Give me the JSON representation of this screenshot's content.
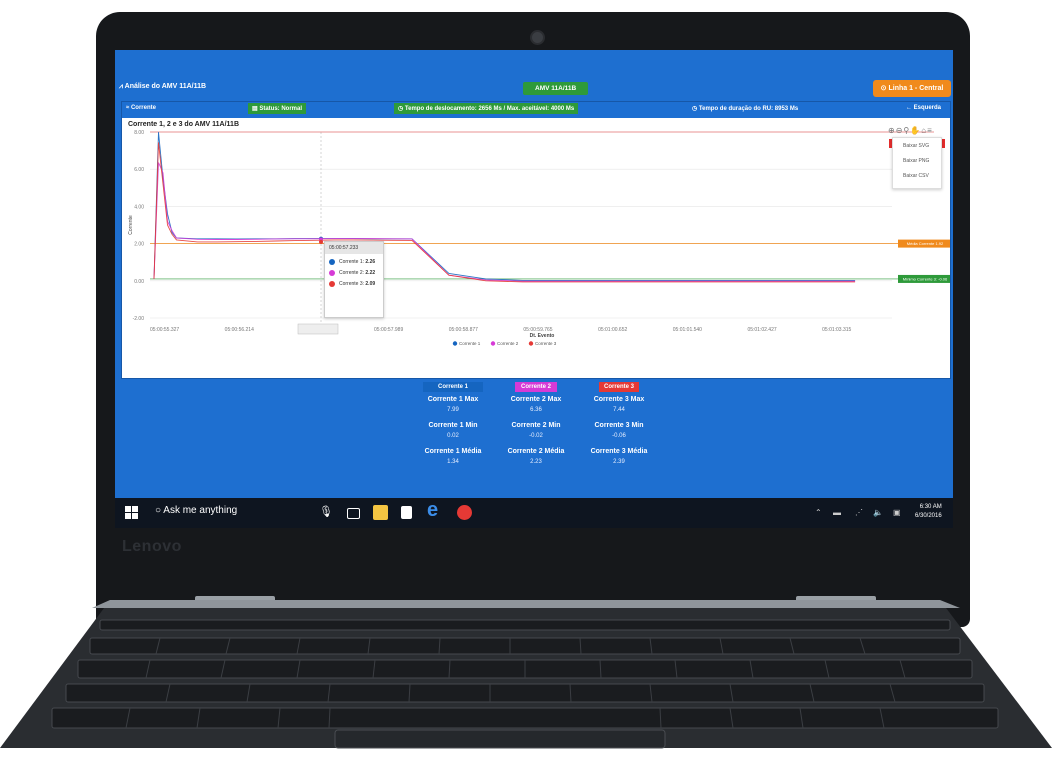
{
  "device": {
    "brand": "Lenovo"
  },
  "app": {
    "title": "Análise do AMV 11A/11B",
    "center_badge": "AMV 11A/11B",
    "line_button": "Linha 1 - Central"
  },
  "panel": {
    "current_label": "Corrente",
    "status_label": "Status: Normal",
    "displacement_time": "Tempo de deslocamento: 2656 Ms / Max. aceitável: 4000 Ms",
    "duration_time": "Tempo de duração do RU: 8953 Ms",
    "direction": "← Esquerda"
  },
  "chart_data": {
    "type": "line",
    "title": "Corrente 1, 2 e 3 do AMV 11A/11B",
    "xlabel": "Dt. Evento",
    "ylabel": "Corrente",
    "ylim": [
      -2,
      8
    ],
    "yticks": [
      "8.00",
      "6.00",
      "4.00",
      "2.00",
      "0.00",
      "-2.00"
    ],
    "xtick_labels": [
      "05:00:55.327",
      "05:00:56.214",
      "05:00:57.233",
      "05:00:57.989",
      "05:00:58.877",
      "05:00:59.765",
      "05:01:00.652",
      "05:01:01.540",
      "05:01:02.427",
      "05:01:03.315"
    ],
    "legend": [
      "Corrente 1",
      "Corrente 2",
      "Corrente 3"
    ],
    "series": [
      {
        "name": "Corrente 1",
        "color": "#1565c0",
        "values": [
          0.1,
          7.99,
          5.5,
          3.6,
          2.6,
          2.3,
          2.26,
          2.26,
          2.25,
          2.26,
          2.26,
          2.27,
          2.27,
          2.27,
          2.27,
          2.26,
          2.26,
          2.26,
          0.4,
          0.1,
          0.02,
          0.02,
          0.02,
          0.02,
          0.02,
          0.02,
          0.02,
          0.02,
          0.02,
          0.02
        ]
      },
      {
        "name": "Corrente 2",
        "color": "#d63ad6",
        "values": [
          0.1,
          6.36,
          5.8,
          3.2,
          2.7,
          2.3,
          2.23,
          2.22,
          2.22,
          2.23,
          2.25,
          2.26,
          2.26,
          2.27,
          2.28,
          2.27,
          2.26,
          2.25,
          0.3,
          0.05,
          -0.02,
          -0.02,
          -0.02,
          -0.02,
          -0.02,
          -0.02,
          -0.02,
          -0.02,
          -0.02,
          -0.02
        ]
      },
      {
        "name": "Corrente 3",
        "color": "#e53935",
        "values": [
          0.1,
          7.44,
          5.2,
          3.0,
          2.5,
          2.2,
          2.09,
          2.09,
          2.1,
          2.12,
          2.14,
          2.16,
          2.18,
          2.2,
          2.2,
          2.19,
          2.18,
          2.17,
          0.3,
          0.0,
          -0.06,
          -0.06,
          -0.06,
          -0.06,
          -0.06,
          -0.06,
          -0.06,
          -0.06,
          -0.06,
          -0.06
        ]
      }
    ],
    "reference_lines": [
      {
        "label": "Média Corrente 1.92",
        "value": 2.0,
        "color": "#f08a1c"
      },
      {
        "label": "Mínimo Corrente 3: -0.06",
        "value": 0.1,
        "color": "#2e9a3a"
      },
      {
        "label": "",
        "value": 8.0,
        "color": "#e57373"
      }
    ],
    "tooltip": {
      "header": "05:00:57.233",
      "rows": [
        {
          "name": "Corrente 1",
          "value": "2.26",
          "color": "#1565c0"
        },
        {
          "name": "Corrente 2",
          "value": "2.22",
          "color": "#d63ad6"
        },
        {
          "name": "Corrente 3",
          "value": "2.09",
          "color": "#e53935"
        }
      ]
    },
    "export_menu": [
      "Baixar SVG",
      "Baixar PNG",
      "Baixar CSV"
    ]
  },
  "stats": {
    "chips": [
      {
        "label": "Corrente 1",
        "color": "#1565c0"
      },
      {
        "label": "Corrente 2",
        "color": "#d63ad6"
      },
      {
        "label": "Corrente 3",
        "color": "#e53935"
      }
    ],
    "c1": {
      "max_label": "Corrente 1 Max",
      "max": "7.99",
      "min_label": "Corrente 1 Min",
      "min": "0.02",
      "avg_label": "Corrente 1 Média",
      "avg": "1.34"
    },
    "c2": {
      "max_label": "Corrente 2 Max",
      "max": "6.36",
      "min_label": "Corrente 2 Min",
      "min": "-0.02",
      "avg_label": "Corrente 2 Média",
      "avg": "2.23"
    },
    "c3": {
      "max_label": "Corrente 3 Max",
      "max": "7.44",
      "min_label": "Corrente 3 Min",
      "min": "-0.06",
      "avg_label": "Corrente 3 Média",
      "avg": "2.39"
    }
  },
  "taskbar": {
    "search": "Ask me anything",
    "time": "6:30 AM",
    "date": "6/30/2016"
  }
}
